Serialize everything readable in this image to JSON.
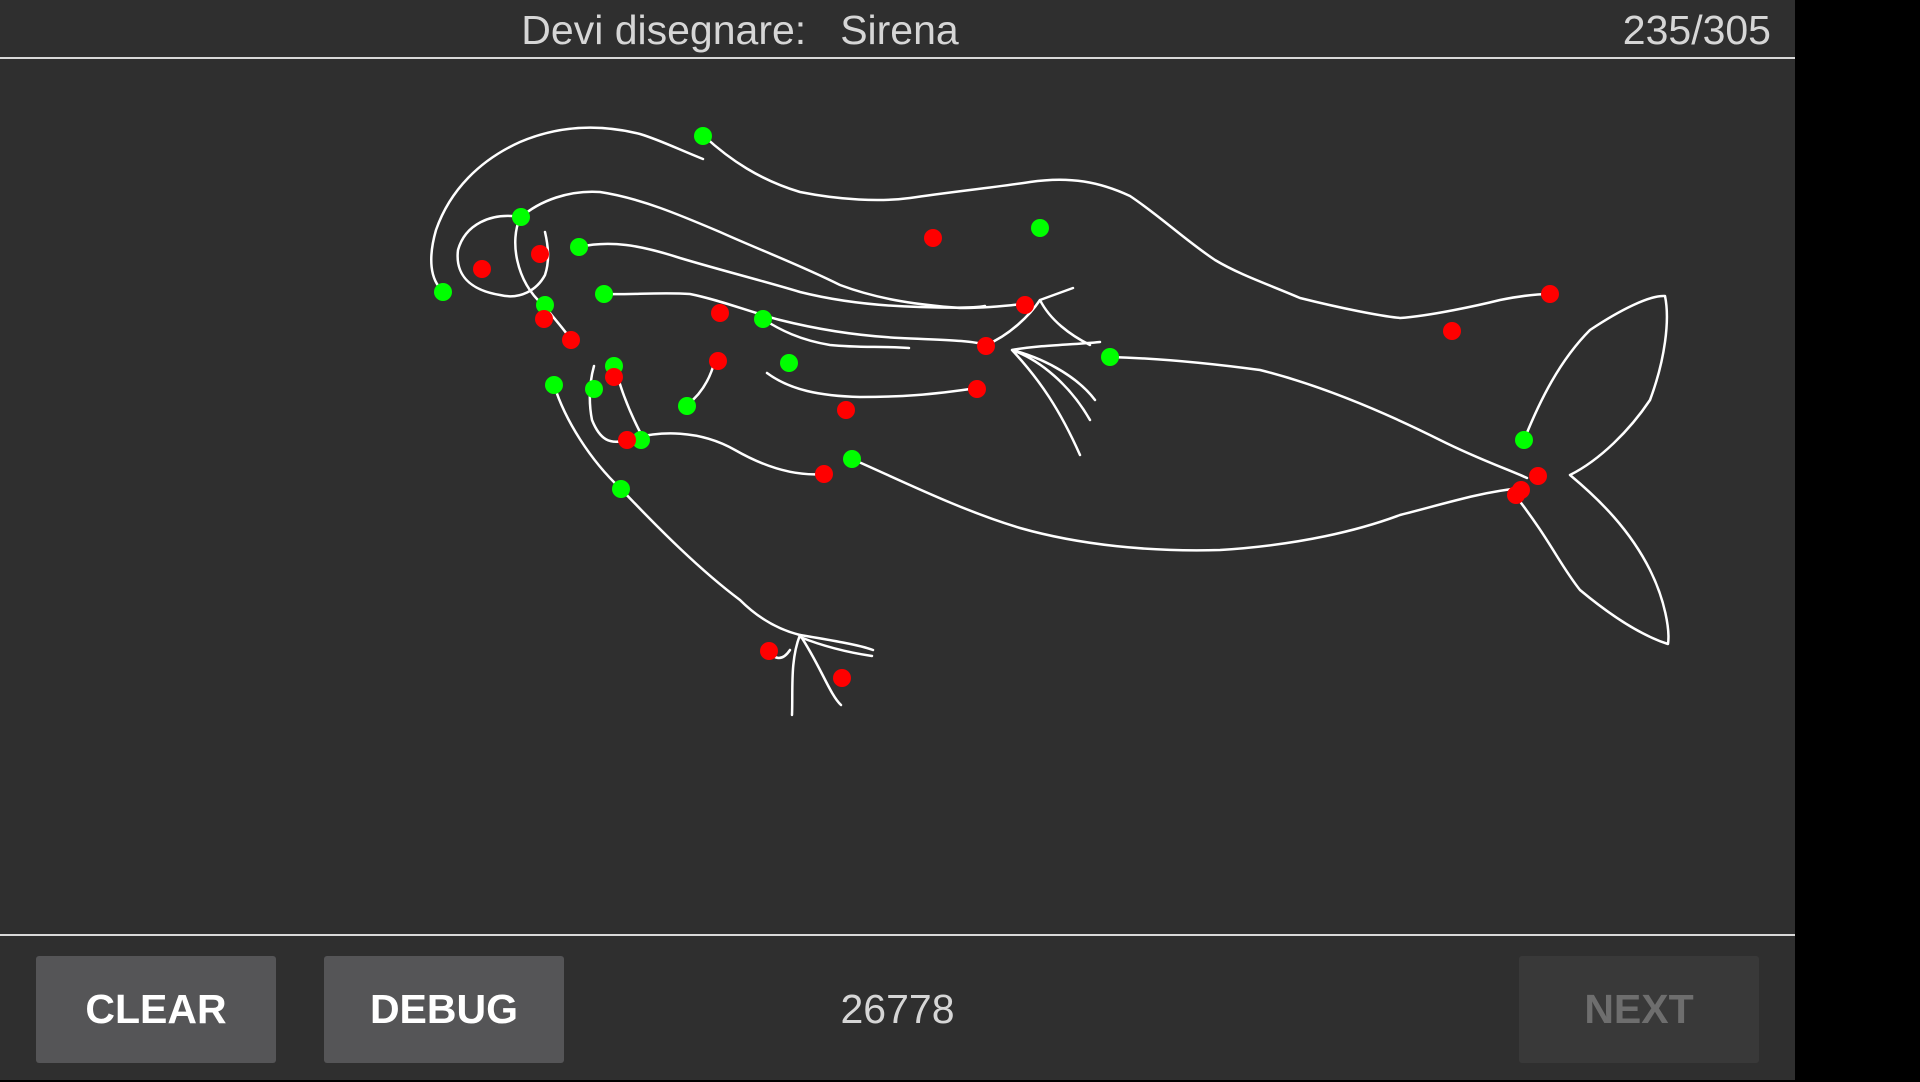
{
  "header": {
    "prompt_label": "Devi disegnare:",
    "prompt_word": "Sirena",
    "progress": "235/305"
  },
  "canvas": {
    "stroke_color": "#ffffff",
    "start_color": "#00ff00",
    "end_color": "#ff0000"
  },
  "footer": {
    "clear_label": "CLEAR",
    "debug_label": "DEBUG",
    "score": "26778",
    "next_label": "NEXT"
  }
}
